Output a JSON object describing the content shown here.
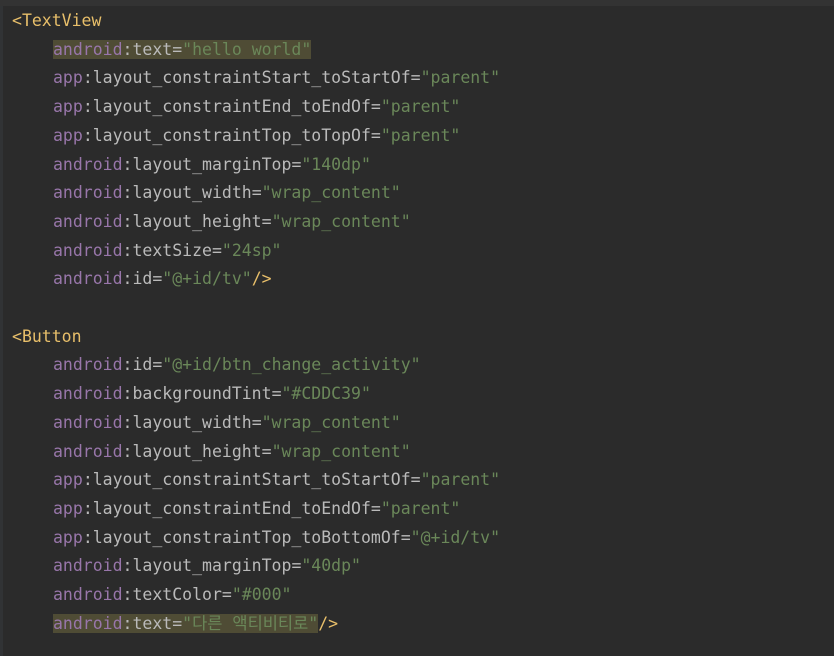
{
  "editor": {
    "lines": [
      [
        {
          "t": "<",
          "c": "c-punct"
        },
        {
          "t": "TextView",
          "c": "c-tag"
        }
      ],
      [
        {
          "t": "android",
          "c": "c-ns",
          "hl": true
        },
        {
          "t": ":text",
          "c": "c-attr",
          "hl": true
        },
        {
          "t": "=",
          "c": "c-eq",
          "hl": true
        },
        {
          "t": "\"hello world\"",
          "c": "c-val",
          "hl": true
        }
      ],
      [
        {
          "t": "app",
          "c": "c-ns"
        },
        {
          "t": ":layout_constraintStart_toStartOf",
          "c": "c-attr"
        },
        {
          "t": "=",
          "c": "c-eq"
        },
        {
          "t": "\"parent\"",
          "c": "c-val"
        }
      ],
      [
        {
          "t": "app",
          "c": "c-ns"
        },
        {
          "t": ":layout_constraintEnd_toEndOf",
          "c": "c-attr"
        },
        {
          "t": "=",
          "c": "c-eq"
        },
        {
          "t": "\"parent\"",
          "c": "c-val"
        }
      ],
      [
        {
          "t": "app",
          "c": "c-ns"
        },
        {
          "t": ":layout_constraintTop_toTopOf",
          "c": "c-attr"
        },
        {
          "t": "=",
          "c": "c-eq"
        },
        {
          "t": "\"parent\"",
          "c": "c-val"
        }
      ],
      [
        {
          "t": "android",
          "c": "c-ns"
        },
        {
          "t": ":layout_marginTop",
          "c": "c-attr"
        },
        {
          "t": "=",
          "c": "c-eq"
        },
        {
          "t": "\"140dp\"",
          "c": "c-val"
        }
      ],
      [
        {
          "t": "android",
          "c": "c-ns"
        },
        {
          "t": ":layout_width",
          "c": "c-attr"
        },
        {
          "t": "=",
          "c": "c-eq"
        },
        {
          "t": "\"wrap_content\"",
          "c": "c-val"
        }
      ],
      [
        {
          "t": "android",
          "c": "c-ns"
        },
        {
          "t": ":layout_height",
          "c": "c-attr"
        },
        {
          "t": "=",
          "c": "c-eq"
        },
        {
          "t": "\"wrap_content\"",
          "c": "c-val"
        }
      ],
      [
        {
          "t": "android",
          "c": "c-ns"
        },
        {
          "t": ":textSize",
          "c": "c-attr"
        },
        {
          "t": "=",
          "c": "c-eq"
        },
        {
          "t": "\"24sp\"",
          "c": "c-val"
        }
      ],
      [
        {
          "t": "android",
          "c": "c-ns"
        },
        {
          "t": ":id",
          "c": "c-attr"
        },
        {
          "t": "=",
          "c": "c-eq"
        },
        {
          "t": "\"@+id/tv\"",
          "c": "c-val"
        },
        {
          "t": "/>",
          "c": "c-close"
        }
      ],
      [],
      [
        {
          "t": "<",
          "c": "c-punct"
        },
        {
          "t": "Button",
          "c": "c-tag"
        }
      ],
      [
        {
          "t": "android",
          "c": "c-ns"
        },
        {
          "t": ":id",
          "c": "c-attr"
        },
        {
          "t": "=",
          "c": "c-eq"
        },
        {
          "t": "\"@+id/btn_change_activity\"",
          "c": "c-val"
        }
      ],
      [
        {
          "t": "android",
          "c": "c-ns"
        },
        {
          "t": ":backgroundTint",
          "c": "c-attr"
        },
        {
          "t": "=",
          "c": "c-eq"
        },
        {
          "t": "\"#CDDC39\"",
          "c": "c-val"
        }
      ],
      [
        {
          "t": "android",
          "c": "c-ns"
        },
        {
          "t": ":layout_width",
          "c": "c-attr"
        },
        {
          "t": "=",
          "c": "c-eq"
        },
        {
          "t": "\"wrap_content\"",
          "c": "c-val"
        }
      ],
      [
        {
          "t": "android",
          "c": "c-ns"
        },
        {
          "t": ":layout_height",
          "c": "c-attr"
        },
        {
          "t": "=",
          "c": "c-eq"
        },
        {
          "t": "\"wrap_content\"",
          "c": "c-val"
        }
      ],
      [
        {
          "t": "app",
          "c": "c-ns"
        },
        {
          "t": ":layout_constraintStart_toStartOf",
          "c": "c-attr"
        },
        {
          "t": "=",
          "c": "c-eq"
        },
        {
          "t": "\"parent\"",
          "c": "c-val"
        }
      ],
      [
        {
          "t": "app",
          "c": "c-ns"
        },
        {
          "t": ":layout_constraintEnd_toEndOf",
          "c": "c-attr"
        },
        {
          "t": "=",
          "c": "c-eq"
        },
        {
          "t": "\"parent\"",
          "c": "c-val"
        }
      ],
      [
        {
          "t": "app",
          "c": "c-ns"
        },
        {
          "t": ":layout_constraintTop_toBottomOf",
          "c": "c-attr"
        },
        {
          "t": "=",
          "c": "c-eq"
        },
        {
          "t": "\"@+id/tv\"",
          "c": "c-val"
        }
      ],
      [
        {
          "t": "android",
          "c": "c-ns"
        },
        {
          "t": ":layout_marginTop",
          "c": "c-attr"
        },
        {
          "t": "=",
          "c": "c-eq"
        },
        {
          "t": "\"40dp\"",
          "c": "c-val"
        }
      ],
      [
        {
          "t": "android",
          "c": "c-ns"
        },
        {
          "t": ":textColor",
          "c": "c-attr"
        },
        {
          "t": "=",
          "c": "c-eq"
        },
        {
          "t": "\"#000\"",
          "c": "c-val"
        }
      ],
      [
        {
          "t": "android",
          "c": "c-ns",
          "hl": true
        },
        {
          "t": ":text",
          "c": "c-attr",
          "hl": true
        },
        {
          "t": "=",
          "c": "c-eq",
          "hl": true
        },
        {
          "t": "\"다른 액티비티로\"",
          "c": "c-val",
          "hl": true
        },
        {
          "t": "/>",
          "c": "c-close"
        }
      ]
    ]
  },
  "colors": {
    "background": "#2b2b2b",
    "tag": "#e8bf6a",
    "namespace": "#9876aa",
    "attribute": "#bababa",
    "string_value": "#6a8759",
    "highlight": "#4f4c35"
  }
}
